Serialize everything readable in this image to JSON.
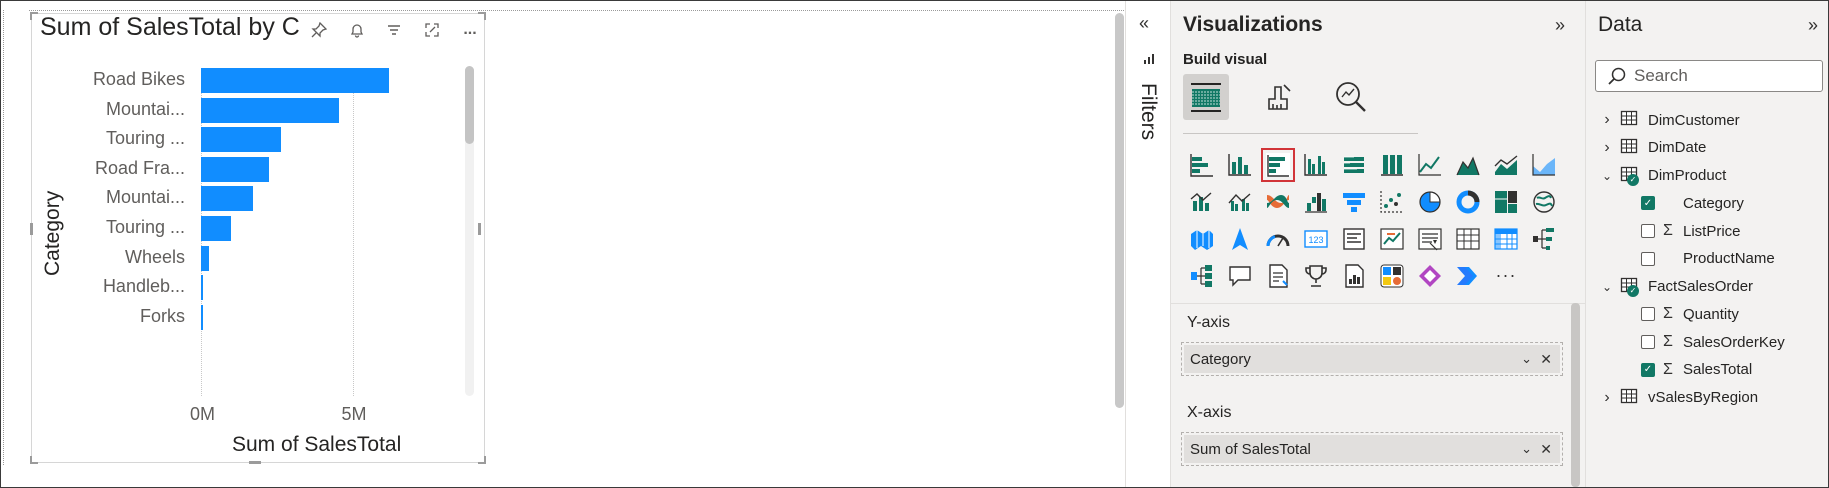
{
  "chart_data": {
    "type": "bar",
    "orientation": "horizontal",
    "title": "Sum of SalesTotal by C",
    "xlabel": "Sum of SalesTotal",
    "ylabel": "Category",
    "categories": [
      "Road Bikes",
      "Mountai...",
      "Touring ...",
      "Road Fra...",
      "Mountai...",
      "Touring ...",
      "Wheels",
      "Handleb...",
      "Forks"
    ],
    "values": [
      6200000,
      4550000,
      2650000,
      2250000,
      1700000,
      980000,
      250000,
      60000,
      50000
    ],
    "xlim": [
      0,
      6500000
    ],
    "xticks": [
      "0M",
      "5M"
    ],
    "bar_color": "#118dff",
    "grid": true
  },
  "visual_toolbar": {
    "pin": "pin-icon",
    "alert": "bell-icon",
    "filter": "filter-icon",
    "focus": "focus-mode-icon",
    "more": "..."
  },
  "filters": {
    "label": "Filters",
    "collapse": "«",
    "icon": "filter-pane-icon"
  },
  "visualizations": {
    "title": "Visualizations",
    "expand": "»",
    "subtitle": "Build visual",
    "tabs": [
      "build-visual",
      "format-visual",
      "analytics"
    ],
    "gallery_more": "···",
    "wells": [
      {
        "label": "Y-axis",
        "field": "Category"
      },
      {
        "label": "X-axis",
        "field": "Sum of SalesTotal"
      }
    ],
    "selection_color": "#d13438"
  },
  "data": {
    "title": "Data",
    "expand": "»",
    "search_placeholder": "Search",
    "tables": [
      {
        "name": "DimCustomer",
        "expanded": false,
        "checked": false
      },
      {
        "name": "DimDate",
        "expanded": false,
        "checked": false
      },
      {
        "name": "DimProduct",
        "expanded": true,
        "checked": true,
        "fields": [
          {
            "name": "Category",
            "sigma": false,
            "checked": true
          },
          {
            "name": "ListPrice",
            "sigma": true,
            "checked": false
          },
          {
            "name": "ProductName",
            "sigma": false,
            "checked": false
          }
        ]
      },
      {
        "name": "FactSalesOrder",
        "expanded": true,
        "checked": true,
        "fields": [
          {
            "name": "Quantity",
            "sigma": true,
            "checked": false
          },
          {
            "name": "SalesOrderKey",
            "sigma": true,
            "checked": false
          },
          {
            "name": "SalesTotal",
            "sigma": true,
            "checked": true
          }
        ]
      },
      {
        "name": "vSalesByRegion",
        "expanded": false,
        "checked": false
      }
    ],
    "accent": "#117865"
  }
}
